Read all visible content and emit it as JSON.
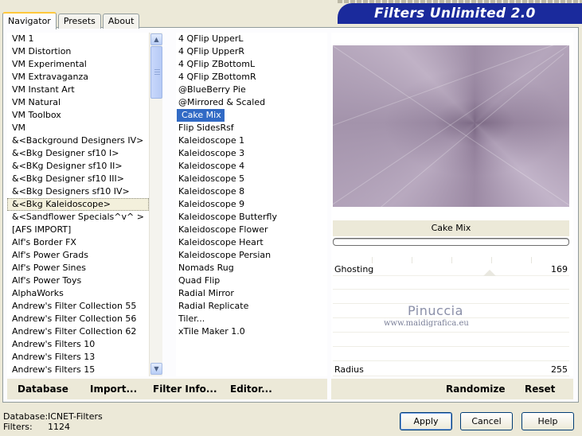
{
  "tabs": [
    "Navigator",
    "Presets",
    "About"
  ],
  "active_tab": "Navigator",
  "banner_title": "Filters Unlimited 2.0",
  "categories": [
    "VM 1",
    "VM Distortion",
    "VM Experimental",
    "VM Extravaganza",
    "VM Instant Art",
    "VM Natural",
    "VM Toolbox",
    "VM",
    "&<Background Designers IV>",
    "&<Bkg Designer sf10 I>",
    "&<BKg Designer sf10 II>",
    "&<Bkg Designer sf10 III>",
    "&<Bkg Designers sf10 IV>",
    "&<Bkg Kaleidoscope>",
    "&<Sandflower Specials^v^ >",
    "[AFS IMPORT]",
    "Alf's Border FX",
    "Alf's Power Grads",
    "Alf's Power Sines",
    "Alf's Power Toys",
    "AlphaWorks",
    "Andrew's Filter Collection 55",
    "Andrew's Filter Collection 56",
    "Andrew's Filter Collection 62",
    "Andrew's Filters 10",
    "Andrew's Filters 13",
    "Andrew's Filters 15"
  ],
  "selected_category": "&<Bkg Kaleidoscope>",
  "filters": [
    "4 QFlip UpperL",
    "4 QFlip UpperR",
    "4 QFlip ZBottomL",
    "4 QFlip ZBottomR",
    "@BlueBerry Pie",
    "@Mirrored & Scaled",
    "Cake Mix",
    "Flip SidesRsf",
    "Kaleidoscope 1",
    "Kaleidoscope 3",
    "Kaleidoscope 4",
    "Kaleidoscope 5",
    "Kaleidoscope 8",
    "Kaleidoscope 9",
    "Kaleidoscope Butterfly",
    "Kaleidoscope Flower",
    "Kaleidoscope Heart",
    "Kaleidoscope Persian",
    "Nomads Rug",
    "Quad Flip",
    "Radial Mirror",
    "Radial Replicate",
    "Tiler...",
    "xTile Maker 1.0"
  ],
  "selected_filter": "Cake Mix",
  "preview_filter_name": "Cake Mix",
  "sliders": [
    {
      "label": "Ghosting",
      "value": "169",
      "level": 169
    },
    {
      "label": "Radius",
      "value": "255",
      "level": 255
    }
  ],
  "watermark": {
    "line1": "Pinuccia",
    "line2": "www.maidigrafica.eu"
  },
  "left_buttons": [
    "Database",
    "Import...",
    "Filter Info...",
    "Editor..."
  ],
  "right_buttons": [
    "Randomize",
    "Reset"
  ],
  "status": {
    "database_label": "Database:",
    "database_value": "ICNET-Filters",
    "filters_label": "Filters:",
    "filters_value": "1124"
  },
  "dialog_buttons": [
    "Apply",
    "Cancel",
    "Help"
  ],
  "colors": {
    "banner": "#1a2a9c",
    "selection": "#316ac5",
    "tab_highlight": "#ffc83c"
  }
}
